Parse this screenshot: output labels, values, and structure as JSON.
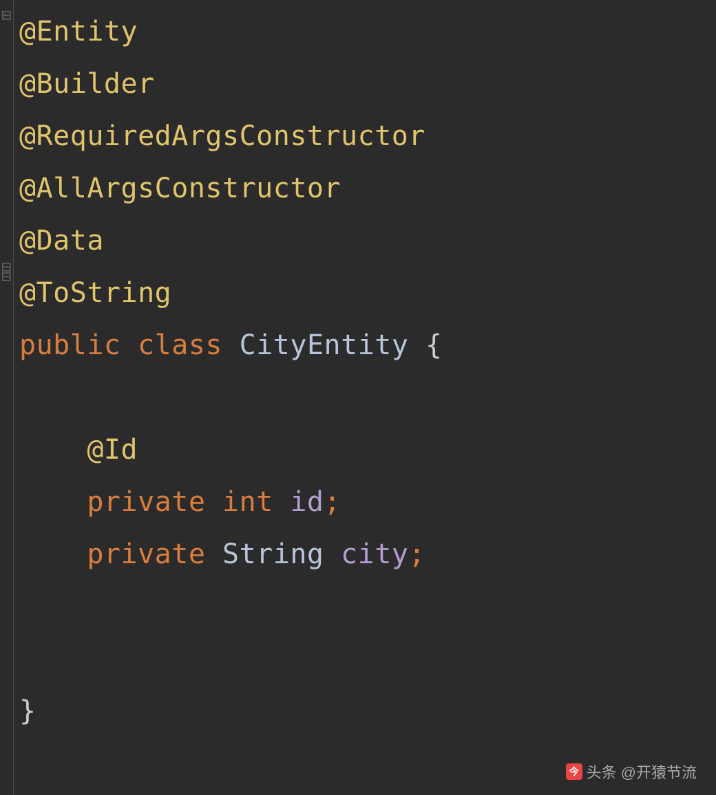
{
  "code": {
    "annotations": {
      "entity": "@Entity",
      "builder": "@Builder",
      "requiredArgs": "@RequiredArgsConstructor",
      "allArgs": "@AllArgsConstructor",
      "data": "@Data",
      "toString": "@ToString",
      "id": "@Id"
    },
    "keywords": {
      "public": "public",
      "class": "class",
      "private1": "private",
      "private2": "private",
      "int": "int"
    },
    "types": {
      "className": "CityEntity",
      "string": "String"
    },
    "fields": {
      "id": "id",
      "city": "city"
    },
    "punct": {
      "openBrace": "{",
      "closeBrace": "}",
      "semi1": ";",
      "semi2": ";"
    }
  },
  "watermark": {
    "label": "头条",
    "handle": "@开猿节流"
  },
  "colors": {
    "background": "#2b2b2b",
    "annotation": "#e0c46c",
    "keyword": "#d87d3e",
    "type": "#b8c4d8",
    "field": "#b39cd0"
  }
}
